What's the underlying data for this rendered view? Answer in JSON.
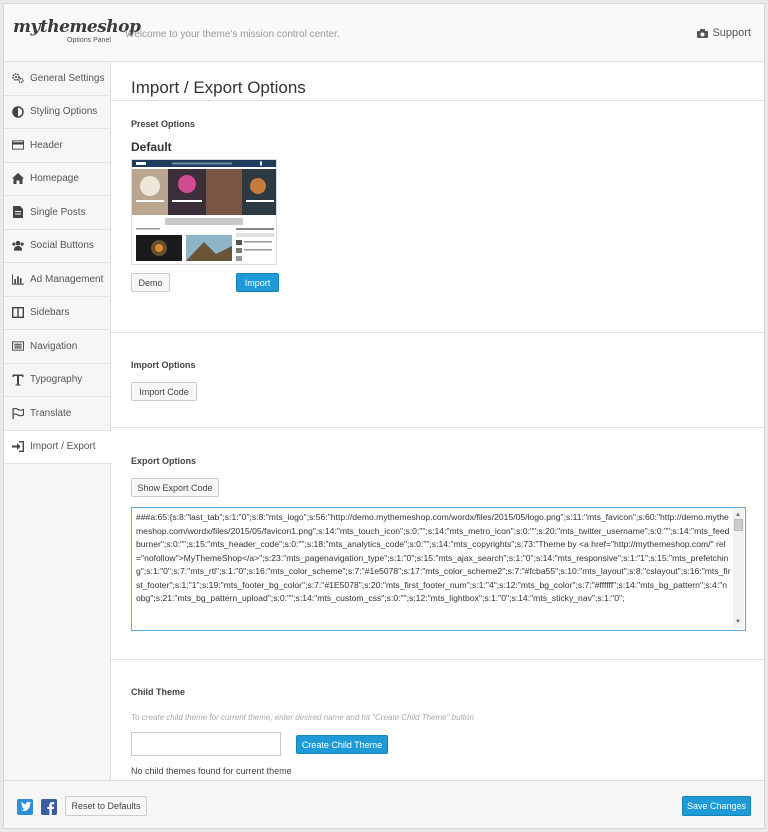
{
  "header": {
    "logo_main": "mythemeshop",
    "logo_sub": "Options Panel",
    "tagline": "Welcome to your theme's mission control center.",
    "support_label": "Support"
  },
  "sidebar": {
    "items": [
      {
        "label": "General Settings",
        "icon": "gears-icon"
      },
      {
        "label": "Styling Options",
        "icon": "contrast-icon"
      },
      {
        "label": "Header",
        "icon": "card-icon"
      },
      {
        "label": "Homepage",
        "icon": "home-icon"
      },
      {
        "label": "Single Posts",
        "icon": "document-icon"
      },
      {
        "label": "Social Buttons",
        "icon": "users-icon"
      },
      {
        "label": "Ad Management",
        "icon": "bar-chart-icon"
      },
      {
        "label": "Sidebars",
        "icon": "columns-icon"
      },
      {
        "label": "Navigation",
        "icon": "menu-icon"
      },
      {
        "label": "Typography",
        "icon": "text-icon"
      },
      {
        "label": "Translate",
        "icon": "flag-icon"
      },
      {
        "label": "Import / Export",
        "icon": "sign-in-icon"
      }
    ],
    "active_index": 11
  },
  "main": {
    "title": "Import / Export Options",
    "preset": {
      "section_label": "Preset Options",
      "name": "Default",
      "demo_label": "Demo",
      "import_label": "Import"
    },
    "import": {
      "section_label": "Import Options",
      "button_label": "Import Code"
    },
    "export": {
      "section_label": "Export Options",
      "button_label": "Show Export Code",
      "code": "###a:65:{s:8:\"last_tab\";s:1:\"0\";s:8:\"mts_logo\";s:56:\"http://demo.mythemeshop.com/wordx/files/2015/05/logo.png\";s:11:\"mts_favicon\";s:60:\"http://demo.mythemeshop.com/wordx/files/2015/05/favicon1.png\";s:14:\"mts_touch_icon\";s:0:\"\";s:14:\"mts_metro_icon\";s:0:\"\";s:20:\"mts_twitter_username\";s:0:\"\";s:14:\"mts_feedburner\";s:0:\"\";s:15:\"mts_header_code\";s:0:\"\";s:18:\"mts_analytics_code\";s:0:\"\";s:14:\"mts_copyrights\";s:73:\"Theme by <a href=\"http://mythemeshop.com/\" rel=\"nofollow\">MyThemeShop</a>\";s:23:\"mts_pagenavigation_type\";s:1:\"0\";s:15:\"mts_ajax_search\";s:1:\"0\";s:14:\"mts_responsive\";s:1:\"1\";s:15:\"mts_prefetching\";s:1:\"0\";s:7:\"mts_rtl\";s:1:\"0\";s:16:\"mts_color_scheme\";s:7:\"#1e5078\";s:17:\"mts_color_scheme2\";s:7:\"#fcba55\";s:10:\"mts_layout\";s:8:\"cslayout\";s:16:\"mts_first_footer\";s:1:\"1\";s:19:\"mts_footer_bg_color\";s:7:\"#1E5078\";s:20:\"mts_first_footer_num\";s:1:\"4\";s:12:\"mts_bg_color\";s:7:\"#ffffff\";s:14:\"mts_bg_pattern\";s:4:\"nobg\";s:21:\"mts_bg_pattern_upload\";s:0:\"\";s:14:\"mts_custom_css\";s:0:\"\";s:12:\"mts_lightbox\";s:1:\"0\";s:14:\"mts_sticky_nav\";s:1:\"0\";"
    },
    "child_theme": {
      "section_label": "Child Theme",
      "hint": "To create child theme for current theme, enter desired name and hit \"Create Child Theme\" button",
      "input_value": "",
      "button_label": "Create Child Theme",
      "status": "No child themes found for current theme"
    }
  },
  "footer": {
    "reset_label": "Reset to Defaults",
    "save_label": "Save Changes",
    "twitter_icon": "twitter-icon",
    "facebook_icon": "facebook-icon"
  },
  "colors": {
    "accent": "#1e9ad6",
    "twitter": "#2d8fd5",
    "facebook": "#3b5ba0"
  }
}
